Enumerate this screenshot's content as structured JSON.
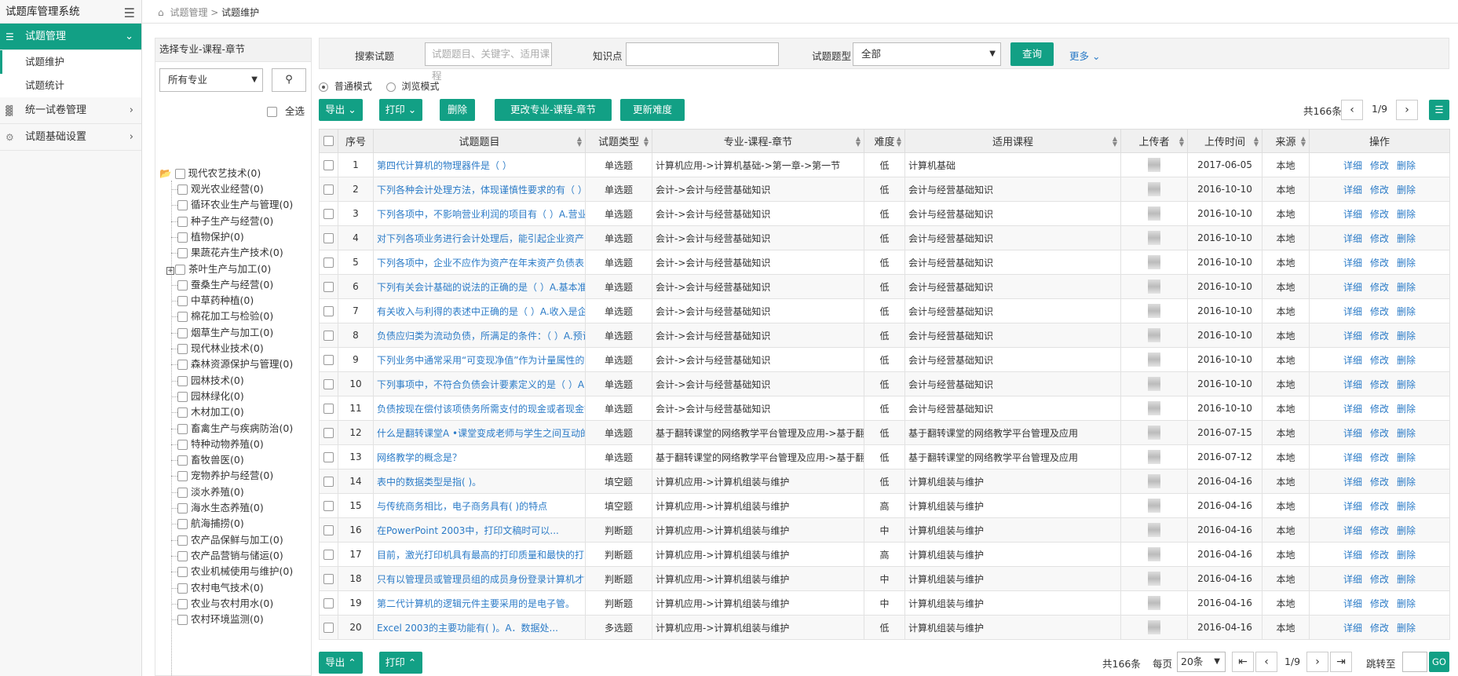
{
  "app": {
    "title": "试题库管理系统"
  },
  "sidebar": {
    "items": [
      {
        "label": "试题管理",
        "active": true,
        "children": [
          {
            "label": "试题维护",
            "active": true
          },
          {
            "label": "试题统计",
            "active": false
          }
        ]
      },
      {
        "label": "统一试卷管理"
      },
      {
        "label": "试题基础设置"
      }
    ]
  },
  "breadcrumb": {
    "parent": "试题管理",
    "current": "试题维护"
  },
  "tree_panel": {
    "title": "选择专业-课程-章节",
    "major_select": "所有专业",
    "select_all": "全选",
    "root": "现代农艺技术(0)",
    "nodes": [
      "观光农业经营(0)",
      "循环农业生产与管理(0)",
      "种子生产与经营(0)",
      "植物保护(0)",
      "果蔬花卉生产技术(0)",
      "茶叶生产与加工(0)",
      "蚕桑生产与经营(0)",
      "中草药种植(0)",
      "棉花加工与检验(0)",
      "烟草生产与加工(0)",
      "现代林业技术(0)",
      "森林资源保护与管理(0)",
      "园林技术(0)",
      "园林绿化(0)",
      "木材加工(0)",
      "畜禽生产与疾病防治(0)",
      "特种动物养殖(0)",
      "畜牧兽医(0)",
      "宠物养护与经营(0)",
      "淡水养殖(0)",
      "海水生态养殖(0)",
      "航海捕捞(0)",
      "农产品保鲜与加工(0)",
      "农产品营销与储运(0)",
      "农业机械使用与维护(0)",
      "农村电气技术(0)",
      "农业与农村用水(0)",
      "农村环境监测(0)"
    ]
  },
  "search": {
    "label": "搜索试题",
    "placeholder": "试题题目、关键字、适用课程",
    "kp_label": "知识点",
    "type_label": "试题题型",
    "type_value": "全部",
    "query_btn": "查询",
    "more": "更多"
  },
  "mode": {
    "normal": "普通模式",
    "browse": "浏览模式"
  },
  "toolbar": {
    "export": "导出",
    "print": "打印",
    "delete": "删除",
    "change": "更改专业-课程-章节",
    "difficulty": "更新难度"
  },
  "pager": {
    "total": "共166条",
    "page": "1/9",
    "per_page_label": "每页",
    "per_page": "20条",
    "jump_label": "跳转至",
    "go": "GO"
  },
  "table": {
    "headers": [
      "序号",
      "试题题目",
      "试题类型",
      "专业-课程-章节",
      "难度",
      "适用课程",
      "上传者",
      "上传时间",
      "来源",
      "操作"
    ],
    "ops": [
      "详细",
      "修改",
      "删除"
    ],
    "rows": [
      {
        "no": "1",
        "title": "第四代计算机的物理器件是（ ）",
        "type": "单选题",
        "chapter": "计算机应用->计算机基础->第一章->第一节",
        "diff": "低",
        "course": "计算机基础",
        "date": "2017-06-05",
        "src": "本地"
      },
      {
        "no": "2",
        "title": "下列各种会计处理方法，体现谨慎性要求的有（ ）A",
        "type": "单选题",
        "chapter": "会计->会计与经营基础知识",
        "diff": "低",
        "course": "会计与经营基础知识",
        "date": "2016-10-10",
        "src": "本地"
      },
      {
        "no": "3",
        "title": "下列各项中，不影响营业利润的项目有（ ）A.营业成",
        "type": "单选题",
        "chapter": "会计->会计与经营基础知识",
        "diff": "低",
        "course": "会计与经营基础知识",
        "date": "2016-10-10",
        "src": "本地"
      },
      {
        "no": "4",
        "title": "对下列各项业务进行会计处理后，能引起企业资产",
        "type": "单选题",
        "chapter": "会计->会计与经营基础知识",
        "diff": "低",
        "course": "会计与经营基础知识",
        "date": "2016-10-10",
        "src": "本地"
      },
      {
        "no": "5",
        "title": "下列各项中，企业不应作为资产在年末资产负债表",
        "type": "单选题",
        "chapter": "会计->会计与经营基础知识",
        "diff": "低",
        "course": "会计与经营基础知识",
        "date": "2016-10-10",
        "src": "本地"
      },
      {
        "no": "6",
        "title": "下列有关会计基础的说法的正确的是（ ）A.基本准则",
        "type": "单选题",
        "chapter": "会计->会计与经营基础知识",
        "diff": "低",
        "course": "会计与经营基础知识",
        "date": "2016-10-10",
        "src": "本地"
      },
      {
        "no": "7",
        "title": "有关收入与利得的表述中正确的是（ ）A.收入是企业",
        "type": "单选题",
        "chapter": "会计->会计与经营基础知识",
        "diff": "低",
        "course": "会计与经营基础知识",
        "date": "2016-10-10",
        "src": "本地"
      },
      {
        "no": "8",
        "title": "负债应归类为流动负债，所满足的条件：（ ）A.预计",
        "type": "单选题",
        "chapter": "会计->会计与经营基础知识",
        "diff": "低",
        "course": "会计与经营基础知识",
        "date": "2016-10-10",
        "src": "本地"
      },
      {
        "no": "9",
        "title": "下列业务中通常采用“可变现净值”作为计量属性的",
        "type": "单选题",
        "chapter": "会计->会计与经营基础知识",
        "diff": "低",
        "course": "会计与经营基础知识",
        "date": "2016-10-10",
        "src": "本地"
      },
      {
        "no": "10",
        "title": "下列事项中，不符合负债会计要素定义的是（ ）A.",
        "type": "单选题",
        "chapter": "会计->会计与经营基础知识",
        "diff": "低",
        "course": "会计与经营基础知识",
        "date": "2016-10-10",
        "src": "本地"
      },
      {
        "no": "11",
        "title": "负债按现在偿付该项债务所需支付的现金或者现金等",
        "type": "单选题",
        "chapter": "会计->会计与经营基础知识",
        "diff": "低",
        "course": "会计与经营基础知识",
        "date": "2016-10-10",
        "src": "本地"
      },
      {
        "no": "12",
        "title": "什么是翻转课堂A •课堂变成老师与学生之间互动的",
        "type": "单选题",
        "chapter": "基于翻转课堂的网络教学平台管理及应用->基于翻",
        "diff": "低",
        "course": "基于翻转课堂的网络教学平台管理及应用",
        "date": "2016-07-15",
        "src": "本地"
      },
      {
        "no": "13",
        "title": "网络教学的概念是？",
        "type": "单选题",
        "chapter": "基于翻转课堂的网络教学平台管理及应用->基于翻",
        "diff": "低",
        "course": "基于翻转课堂的网络教学平台管理及应用",
        "date": "2016-07-12",
        "src": "本地"
      },
      {
        "no": "14",
        "title": "表中的数据类型是指( )。",
        "type": "填空题",
        "chapter": "计算机应用->计算机组装与维护",
        "diff": "低",
        "course": "计算机组装与维护",
        "date": "2016-04-16",
        "src": "本地"
      },
      {
        "no": "15",
        "title": "与传统商务相比，电子商务具有( )的特点",
        "type": "填空题",
        "chapter": "计算机应用->计算机组装与维护",
        "diff": "高",
        "course": "计算机组装与维护",
        "date": "2016-04-16",
        "src": "本地"
      },
      {
        "no": "16",
        "title": "在PowerPoint 2003中，打印文稿时可以...",
        "type": "判断题",
        "chapter": "计算机应用->计算机组装与维护",
        "diff": "中",
        "course": "计算机组装与维护",
        "date": "2016-04-16",
        "src": "本地"
      },
      {
        "no": "17",
        "title": "目前，激光打印机具有最高的打印质量和最快的打印",
        "type": "判断题",
        "chapter": "计算机应用->计算机组装与维护",
        "diff": "高",
        "course": "计算机组装与维护",
        "date": "2016-04-16",
        "src": "本地"
      },
      {
        "no": "18",
        "title": "只有以管理员或管理员组的成员身份登录计算机才能",
        "type": "判断题",
        "chapter": "计算机应用->计算机组装与维护",
        "diff": "中",
        "course": "计算机组装与维护",
        "date": "2016-04-16",
        "src": "本地"
      },
      {
        "no": "19",
        "title": "第二代计算机的逻辑元件主要采用的是电子管。",
        "type": "判断题",
        "chapter": "计算机应用->计算机组装与维护",
        "diff": "中",
        "course": "计算机组装与维护",
        "date": "2016-04-16",
        "src": "本地"
      },
      {
        "no": "20",
        "title": "Excel 2003的主要功能有( )。A．数据处...",
        "type": "多选题",
        "chapter": "计算机应用->计算机组装与维护",
        "diff": "低",
        "course": "计算机组装与维护",
        "date": "2016-04-16",
        "src": "本地"
      }
    ]
  },
  "colors": {
    "accent": "#12a085",
    "link": "#2b7bc7"
  }
}
